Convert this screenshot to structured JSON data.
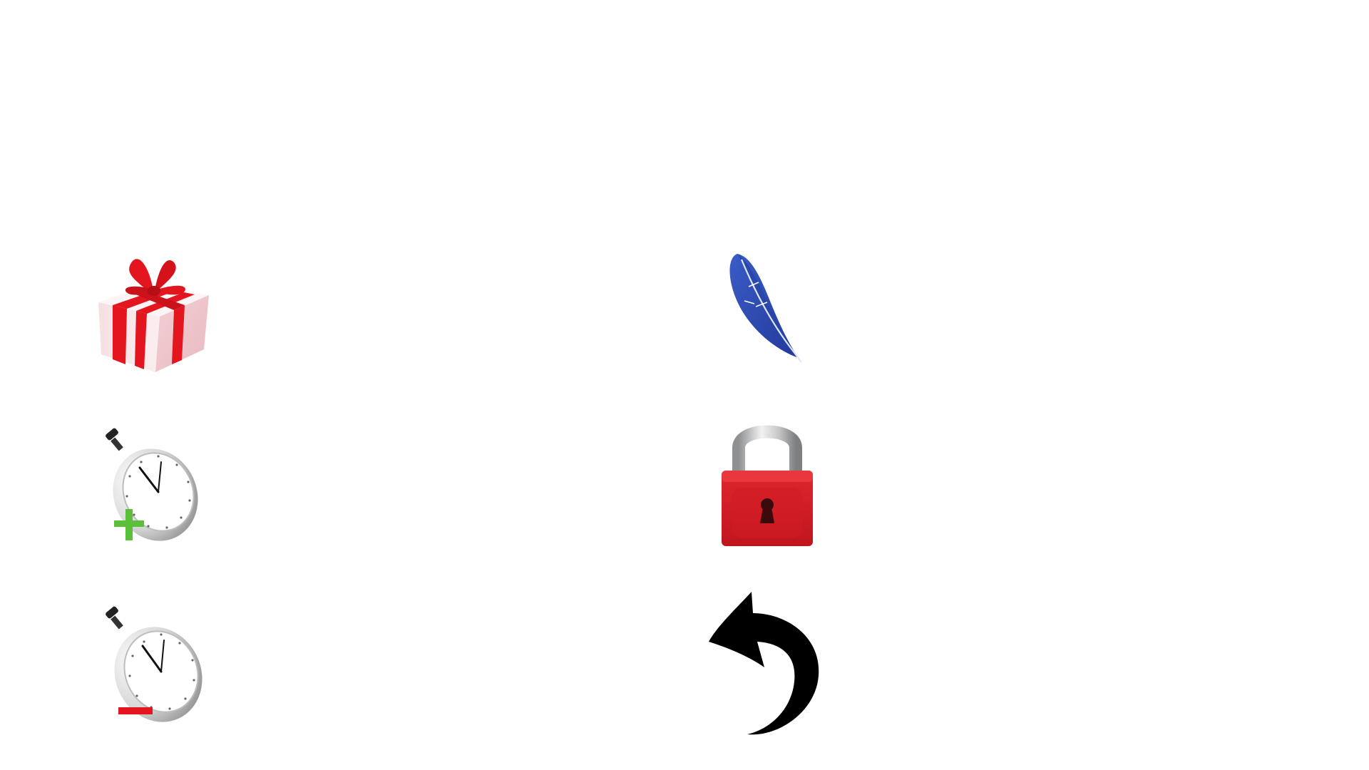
{
  "palette_buttons": [
    {
      "id": "gift",
      "icon": "gift-icon"
    },
    {
      "id": "time-plus",
      "icon": "stopwatch-plus-icon"
    },
    {
      "id": "time-minus",
      "icon": "stopwatch-minus-icon"
    },
    {
      "id": "feather",
      "icon": "feather-icon"
    },
    {
      "id": "lock",
      "icon": "padlock-icon"
    },
    {
      "id": "undo",
      "icon": "undo-arrow-icon"
    }
  ],
  "colors": {
    "background": "#ffffff",
    "ribbon_red": "#e3161f",
    "box_pink": "#f3d4d8",
    "feather_blue": "#2f4db3",
    "lock_red": "#d41f26",
    "shackle_gray": "#bfc1c3",
    "plus_green": "#5bbf3a",
    "minus_red": "#e3161f",
    "arrow_black": "#000000"
  }
}
